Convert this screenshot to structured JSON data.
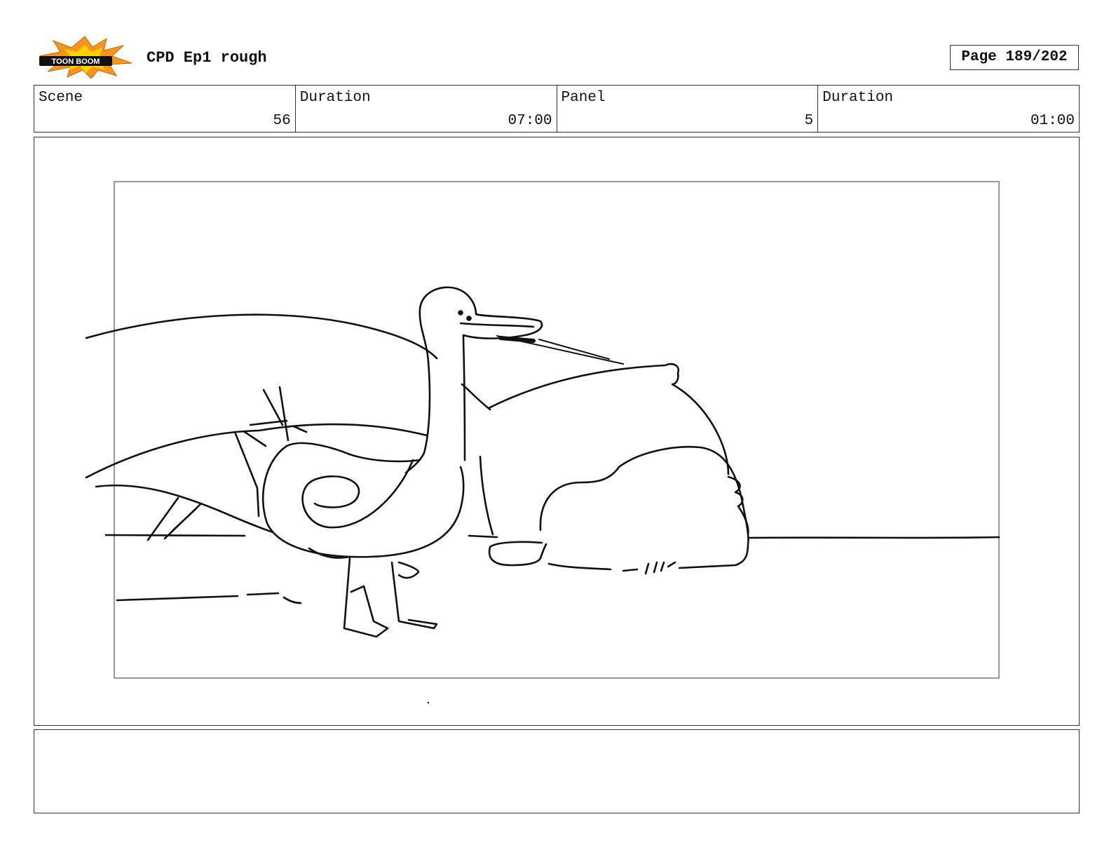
{
  "header": {
    "logo_text": "TOON BOOM",
    "title": "CPD Ep1 rough",
    "page": "Page 189/202"
  },
  "info": {
    "scene_label": "Scene",
    "scene_value": "56",
    "scene_duration_label": "Duration",
    "scene_duration_value": "07:00",
    "panel_label": "Panel",
    "panel_value": "5",
    "panel_duration_label": "Duration",
    "panel_duration_value": "01:00"
  },
  "notes": {
    "text": ""
  },
  "colors": {
    "logo_orange": "#f7941d",
    "logo_yellow": "#ffd200",
    "frame_gray": "#9a9a9a",
    "ink": "#111111"
  }
}
